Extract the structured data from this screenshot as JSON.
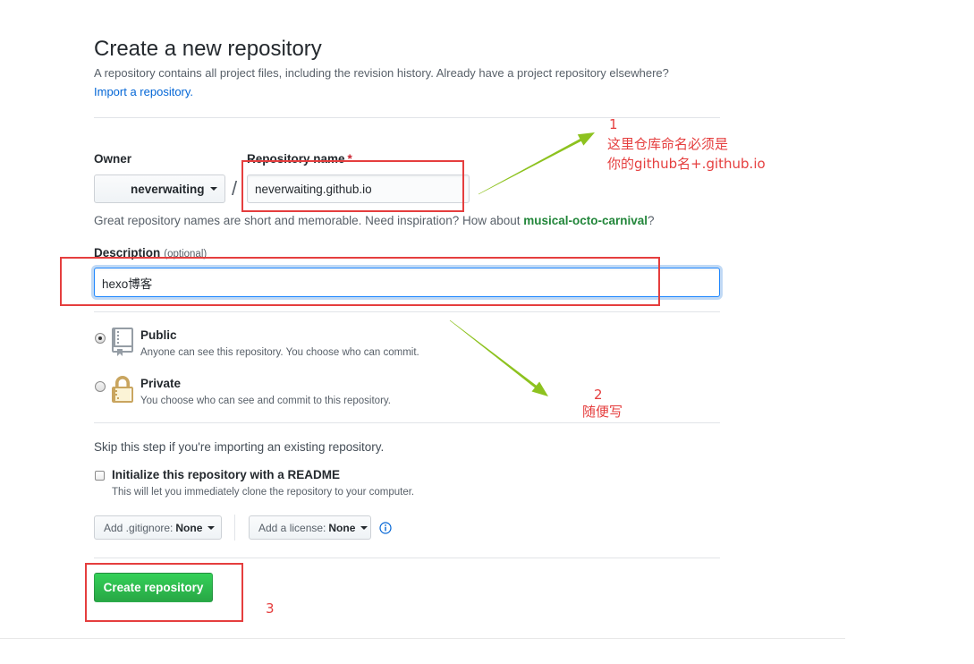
{
  "page": {
    "title": "Create a new repository",
    "subtitle": "A repository contains all project files, including the revision history. Already have a project repository elsewhere?",
    "import_link": "Import a repository."
  },
  "form": {
    "owner_label": "Owner",
    "owner_value": "neverwaiting",
    "repo_name_label": "Repository name",
    "required_mark": "*",
    "separator": "/",
    "repo_name_value": "neverwaiting.github.io",
    "hint_prefix": "Great repository names are short and memorable. Need inspiration? How about ",
    "hint_suggestion": "musical-octo-carnival",
    "hint_suffix": "?",
    "description_label": "Description",
    "description_optional": "(optional)",
    "description_value": "hexo博客",
    "visibility": [
      {
        "label": "Public",
        "note": "Anyone can see this repository. You choose who can commit.",
        "selected": true,
        "icon": "repo-book-icon"
      },
      {
        "label": "Private",
        "note": "You choose who can see and commit to this repository.",
        "selected": false,
        "icon": "lock-icon"
      }
    ],
    "skip_text": "Skip this step if you're importing an existing repository.",
    "readme_label": "Initialize this repository with a README",
    "readme_note": "This will let you immediately clone the repository to your computer.",
    "readme_checked": false,
    "gitignore_prefix": "Add .gitignore:",
    "gitignore_value": "None",
    "license_prefix": "Add a license:",
    "license_value": "None",
    "info_icon": "info-icon",
    "submit_label": "Create repository"
  },
  "annotations": [
    {
      "number": "1",
      "lines": [
        "这里仓库命名必须是",
        "你的github名+.github.io"
      ]
    },
    {
      "number": "2",
      "lines": [
        "随便写"
      ]
    },
    {
      "number": "3"
    }
  ],
  "colors": {
    "link": "#0366d6",
    "suggestion": "#22863a",
    "required": "#cb2431",
    "primary_button": "#28a745",
    "focus_border": "#2188ff",
    "annotation_red": "#e53e3e",
    "annotation_arrow": "#8dc21f"
  }
}
